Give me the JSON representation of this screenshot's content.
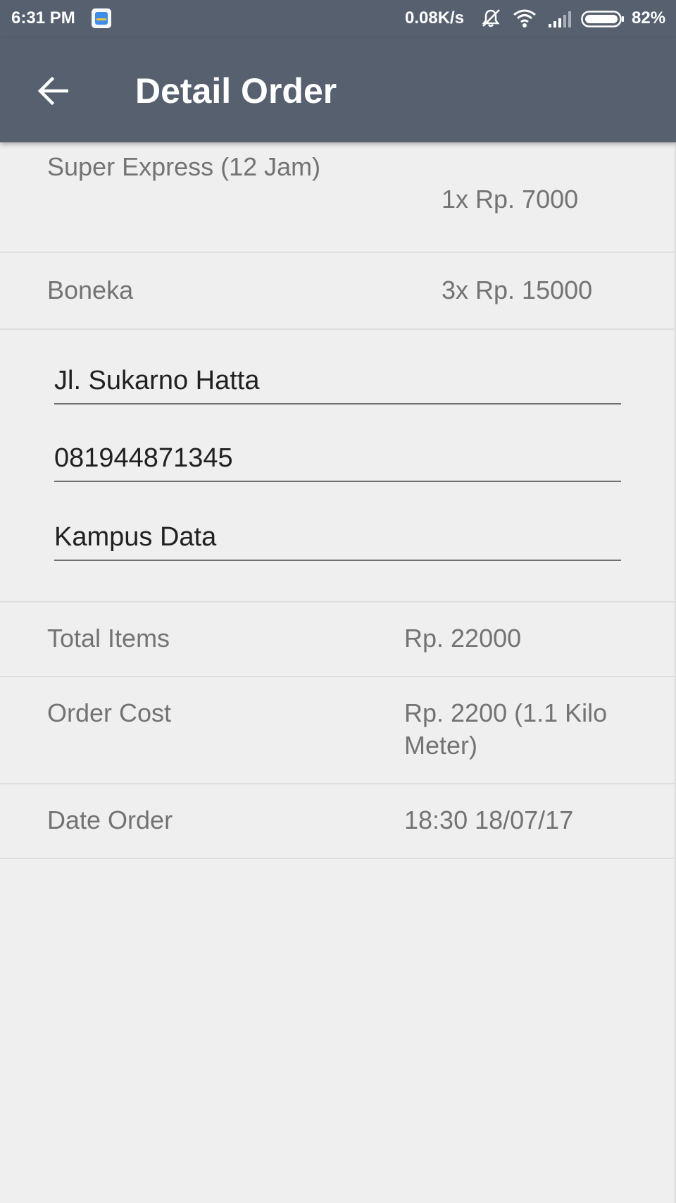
{
  "status_bar": {
    "time": "6:31 PM",
    "network_speed": "0.08K/s",
    "battery": "82%",
    "icons": [
      "app-notification-icon",
      "mute-icon",
      "wifi-icon",
      "signal-icon",
      "battery-icon"
    ]
  },
  "app_bar": {
    "back_icon": "arrow-back-icon",
    "title": "Detail Order",
    "background": "#56606f"
  },
  "order_items": [
    {
      "name": "Super Express (12 Jam)",
      "qty_price": "1x Rp. 7000"
    },
    {
      "name": "Boneka",
      "qty_price": "3x Rp. 15000"
    }
  ],
  "fields": {
    "address": "Jl. Sukarno Hatta",
    "phone": "081944871345",
    "location": "Kampus Data"
  },
  "summary": [
    {
      "label": "Total Items",
      "value": "Rp. 22000"
    },
    {
      "label": "Order Cost",
      "value": "Rp. 2200 (1.1 Kilo Meter)"
    },
    {
      "label": "Date Order",
      "value": "18:30 18/07/17"
    }
  ]
}
